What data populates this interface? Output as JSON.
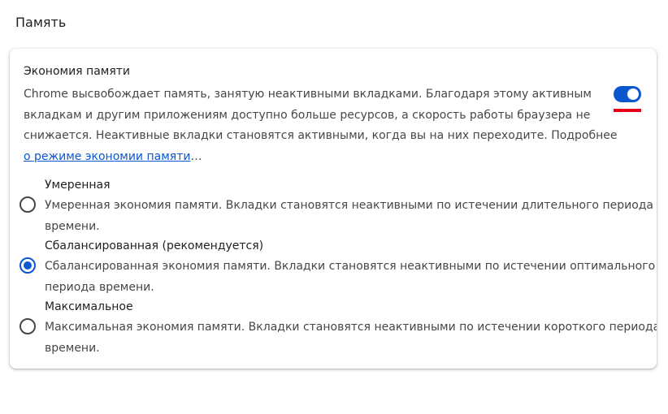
{
  "page": {
    "title": "Память"
  },
  "memory_saver": {
    "title": "Экономия памяти",
    "description": "Chrome высвобождает память, занятую неактивными вкладками. Благодаря этому активным вкладкам и другим приложениям доступно больше ресурсов, а скорость работы браузера не снижается. Неактивные вкладки становятся активными, когда вы на них переходите. Подробнее ",
    "link_text": "о режиме экономии памяти",
    "link_suffix": "…",
    "toggle_on": true,
    "accent_color": "#0b57d0"
  },
  "options": [
    {
      "label": "Умеренная",
      "description": "Умеренная экономия памяти. Вкладки становятся неактивными по истечении длительного периода времени.",
      "checked": false
    },
    {
      "label": "Сбалансированная (рекомендуется)",
      "description": "Сбалансированная экономия памяти. Вкладки становятся неактивными по истечении оптимального периода времени.",
      "checked": true
    },
    {
      "label": "Максимальное",
      "description": "Максимальная экономия памяти. Вкладки становятся неактивными по истечении короткого периода времени.",
      "checked": false
    }
  ]
}
